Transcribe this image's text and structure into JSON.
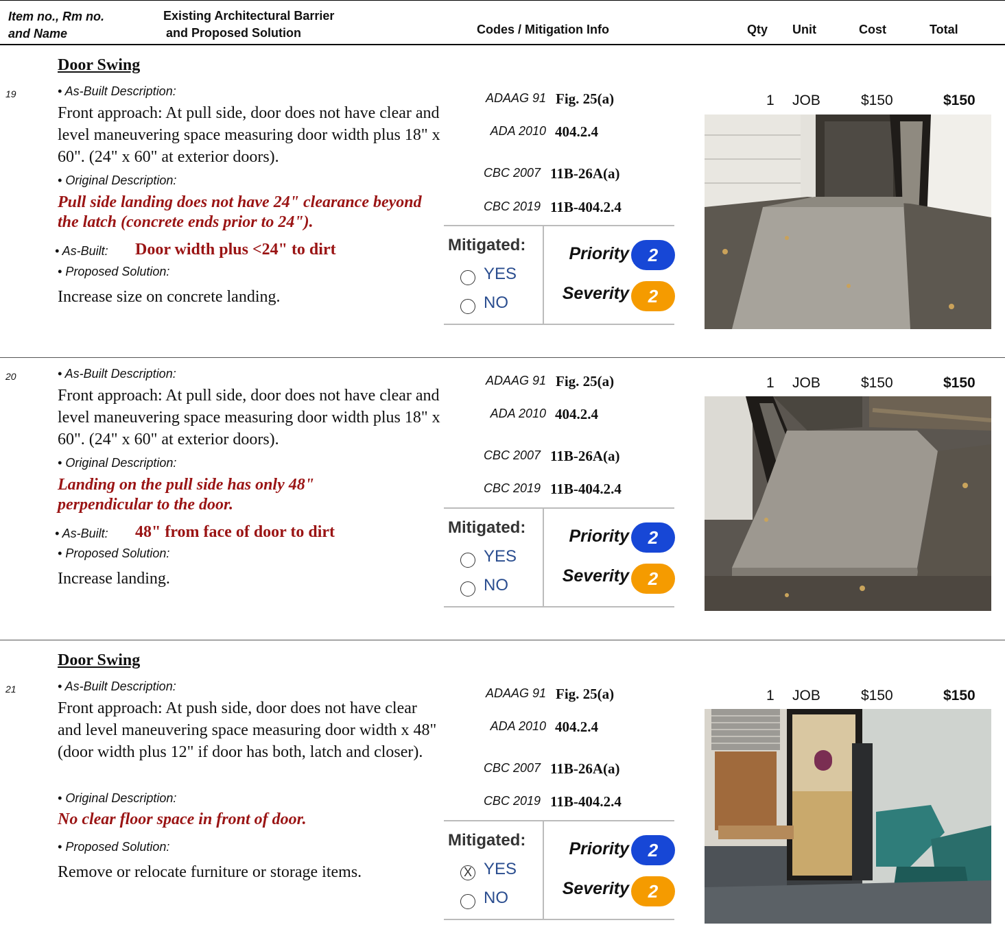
{
  "header": {
    "col1_line1": "Item no., Rm no.",
    "col1_line2": "and Name",
    "col2_line1": "Existing Architectural Barrier",
    "col2_line2": "and Proposed Solution",
    "col3": "Codes / Mitigation Info",
    "qty": "Qty",
    "unit": "Unit",
    "cost": "Cost",
    "total": "Total"
  },
  "labels": {
    "as_built_description": "As-Built Description:",
    "original_description": "Original Description:",
    "as_built": "As-Built:",
    "proposed_solution": "Proposed Solution:",
    "mitigated": "Mitigated:",
    "yes": "YES",
    "no": "NO",
    "priority": "Priority",
    "severity": "Severity",
    "bullet": "•"
  },
  "entries": [
    {
      "section": "Door Swing",
      "number": "19",
      "description": "Front approach: At pull side, door does not have clear and level maneuvering space measuring door width plus 18\" x 60\". (24\" x 60\" at exterior doors).",
      "original": "Pull side landing does not have 24\" clearance beyond the latch (concrete ends prior to 24\").",
      "as_built": "Door width plus <24\" to dirt",
      "solution": "Increase size on concrete landing.",
      "codes": [
        {
          "std": "ADAAG 91",
          "sec": "Fig. 25(a)"
        },
        {
          "std": "ADA 2010",
          "sec": "404.2.4"
        },
        {
          "std": "CBC 2007",
          "sec": "11B-26A(a)"
        },
        {
          "std": "CBC 2019",
          "sec": "11B-404.2.4"
        }
      ],
      "mitigated_yes_mark": "",
      "priority": "2",
      "severity": "2",
      "qty": "1",
      "unit": "JOB",
      "cost": "$150",
      "total": "$150",
      "photo": "photo-exterior-door-concrete-landing"
    },
    {
      "section": "",
      "number": "20",
      "description": "Front approach: At pull side, door does not have clear and level maneuvering space measuring door width plus 18\" x 60\". (24\" x 60\" at exterior doors).",
      "original": "Landing on the pull side has only 48\" perpendicular to the door.",
      "as_built": "48\" from face of door to dirt",
      "solution": "Increase landing.",
      "codes": [
        {
          "std": "ADAAG 91",
          "sec": "Fig. 25(a)"
        },
        {
          "std": "ADA 2010",
          "sec": "404.2.4"
        },
        {
          "std": "CBC 2007",
          "sec": "11B-26A(a)"
        },
        {
          "std": "CBC 2019",
          "sec": "11B-404.2.4"
        }
      ],
      "mitigated_yes_mark": "",
      "priority": "2",
      "severity": "2",
      "qty": "1",
      "unit": "JOB",
      "cost": "$150",
      "total": "$150",
      "photo": "photo-concrete-landing-dirt-edge"
    },
    {
      "section": "Door Swing",
      "number": "21",
      "description": "Front approach: At push side, door does not have clear and level maneuvering space measuring door width x 48\" (door width plus 12\" if door has both, latch and closer).",
      "original": "No clear floor space in front of door.",
      "as_built": "",
      "solution": "Remove or relocate furniture or storage items.",
      "codes": [
        {
          "std": "ADAAG 91",
          "sec": "Fig. 25(a)"
        },
        {
          "std": "ADA 2010",
          "sec": "404.2.4"
        },
        {
          "std": "CBC 2007",
          "sec": "11B-26A(a)"
        },
        {
          "std": "CBC 2019",
          "sec": "11B-404.2.4"
        }
      ],
      "mitigated_yes_mark": "X",
      "priority": "2",
      "severity": "2",
      "qty": "1",
      "unit": "JOB",
      "cost": "$150",
      "total": "$150",
      "photo": "photo-interior-room-chairs-door"
    }
  ],
  "colors": {
    "original_text": "#9a1414",
    "option_text": "#2a4d8f",
    "priority_pill": "#1747d6",
    "severity_pill": "#f59b00"
  }
}
